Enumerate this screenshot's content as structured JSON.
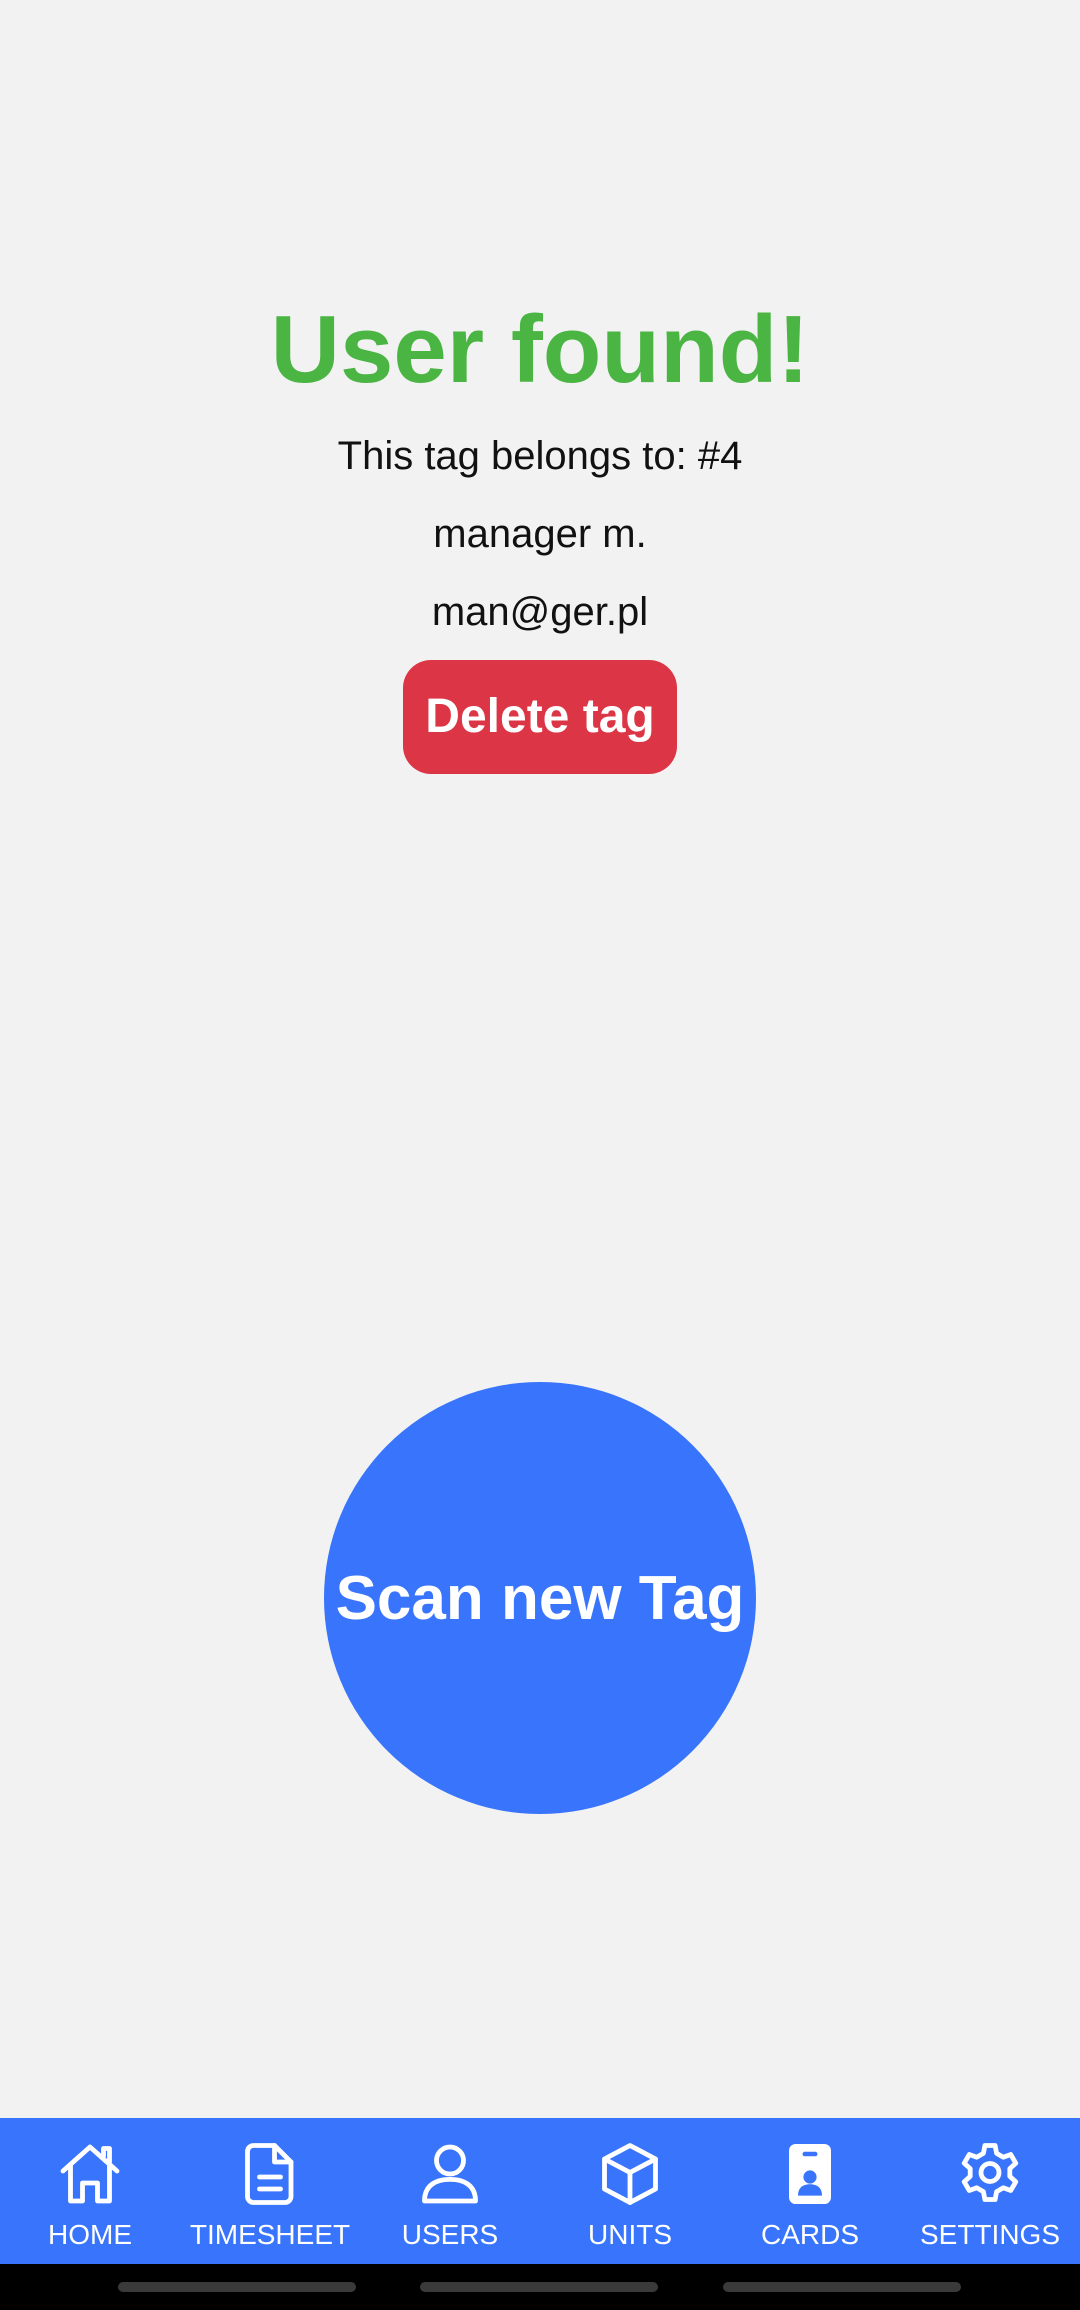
{
  "result": {
    "title": "User found!",
    "owner_text": "This tag belongs to: #4",
    "user_name": "manager m.",
    "user_email": "man@ger.pl",
    "delete_label": "Delete tag"
  },
  "scan": {
    "label": "Scan new Tag"
  },
  "tabs": [
    {
      "label": "HOME",
      "icon": "home-icon"
    },
    {
      "label": "TIMESHEET",
      "icon": "document-icon"
    },
    {
      "label": "USERS",
      "icon": "user-icon"
    },
    {
      "label": "UNITS",
      "icon": "cube-icon"
    },
    {
      "label": "CARDS",
      "icon": "badge-card-icon",
      "active": true
    },
    {
      "label": "SETTINGS",
      "icon": "gear-icon"
    }
  ],
  "colors": {
    "background": "#f2f2f2",
    "success_green": "#4bb543",
    "danger_red": "#dc3545",
    "primary_blue": "#3874fc",
    "text_dark": "#111111",
    "white": "#ffffff"
  }
}
